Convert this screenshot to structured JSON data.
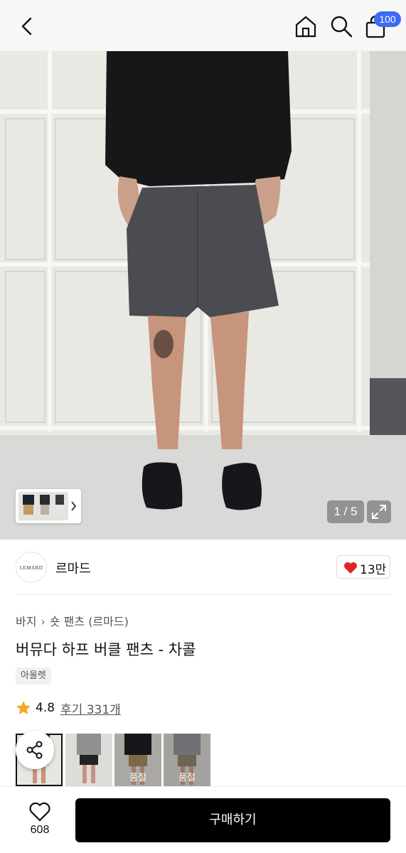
{
  "header": {
    "back_icon": "chevron-left-icon",
    "home_icon": "home-icon",
    "search_icon": "search-icon",
    "cart_icon": "shopping-bag-icon",
    "cart_badge": "100",
    "badge_color": "#3b6cf3"
  },
  "gallery": {
    "counter": "1 / 5",
    "expand_icon": "expand-icon",
    "thumb_arrow_icon": "chevron-right-icon"
  },
  "brand": {
    "logo_text": "LEMARD",
    "name": "르마드",
    "like_count": "13만",
    "heart_color": "#e02525"
  },
  "breadcrumb": {
    "category": "바지",
    "subcategory": "숏 팬츠 (르마드)"
  },
  "product": {
    "title": "버뮤다 하프 버클 팬츠 - 차콜",
    "tag": "아울렛",
    "rating": "4.8",
    "review_link": "후기 331개",
    "star_color": "#f5a623"
  },
  "color_options": [
    {
      "label": "",
      "selected": true
    },
    {
      "label": "",
      "selected": false
    },
    {
      "label": "품절",
      "selected": false
    },
    {
      "label": "품절",
      "selected": false
    }
  ],
  "footer": {
    "wish_count": "608",
    "buy_label": "구매하기",
    "share_icon": "share-icon"
  }
}
